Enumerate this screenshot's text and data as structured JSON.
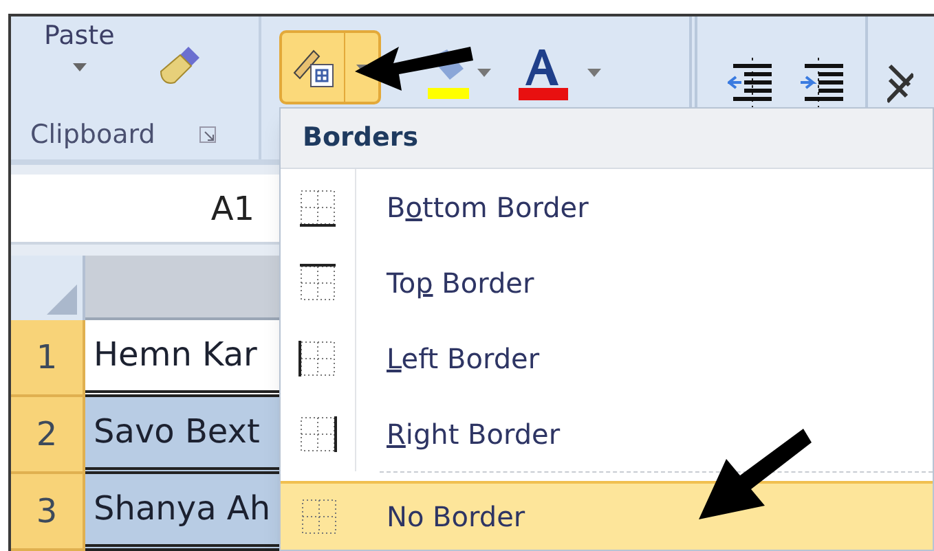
{
  "ribbon": {
    "paste_label": "Paste",
    "clipboard_label": "Clipboard",
    "borders_button": {
      "pressed": true
    }
  },
  "name_box": {
    "value": "A1"
  },
  "rows": [
    {
      "number": "1",
      "cell": "Hemn Kar",
      "selected": false
    },
    {
      "number": "2",
      "cell": "Savo Bext",
      "selected": true
    },
    {
      "number": "3",
      "cell": "Shanya Ah",
      "selected": true
    }
  ],
  "borders_menu": {
    "title": "Borders",
    "items": [
      {
        "kind": "bottom",
        "before": "B",
        "key": "o",
        "after": "ttom Border",
        "selected": false
      },
      {
        "kind": "top",
        "before": "To",
        "key": "p",
        "after": " Border",
        "selected": false
      },
      {
        "kind": "left",
        "key": "L",
        "after": "eft Border",
        "selected": false
      },
      {
        "kind": "right",
        "key": "R",
        "after": "ight Border",
        "selected": false
      },
      {
        "kind": "none",
        "before": "No Border",
        "selected": true
      }
    ]
  }
}
